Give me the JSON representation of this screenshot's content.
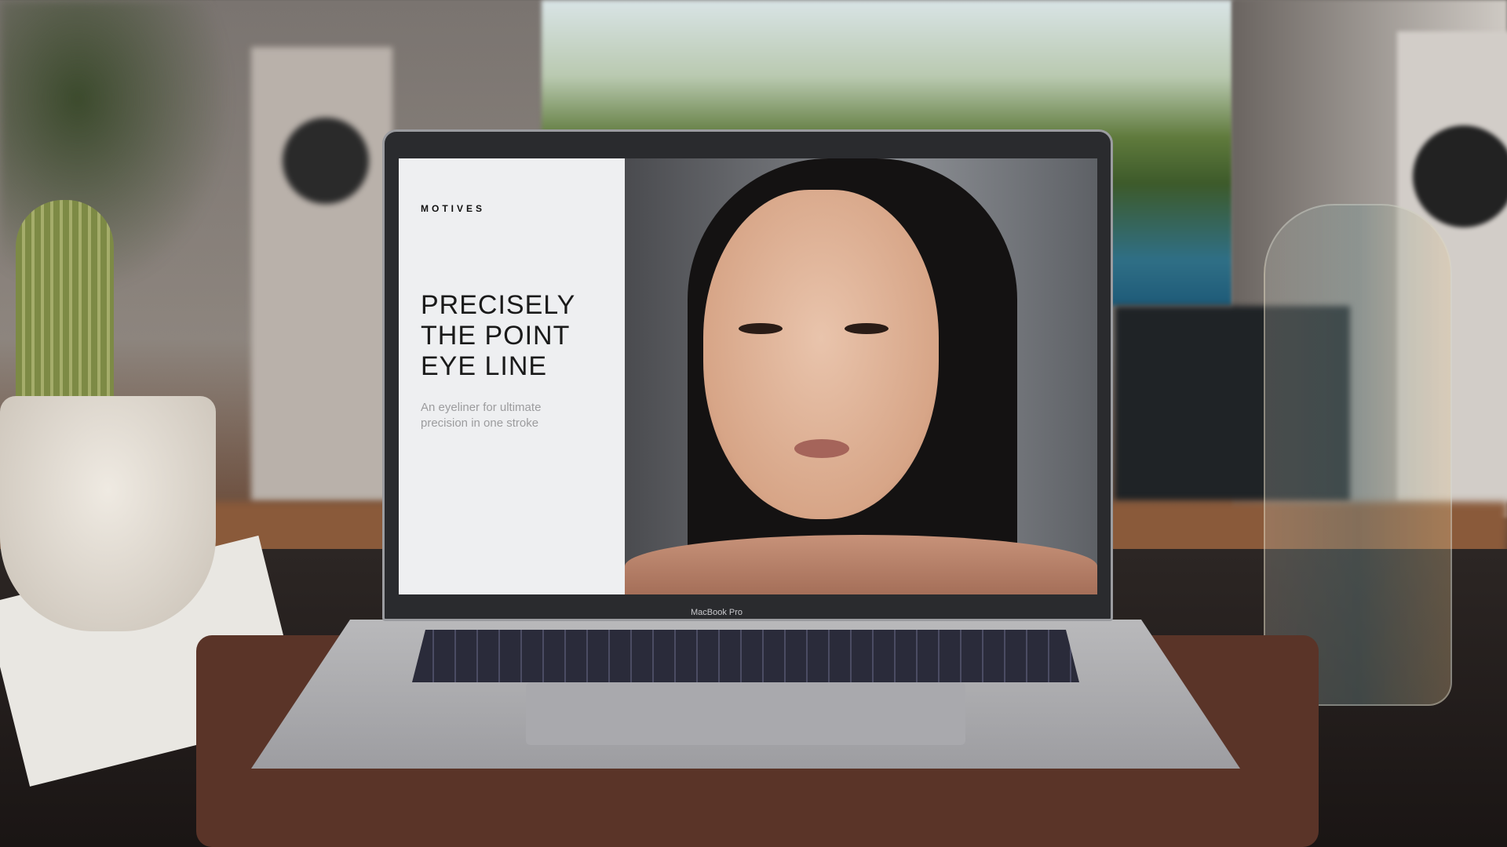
{
  "website": {
    "brand": "MOTIVES",
    "headline": [
      "PRECISELY",
      "THE POINT",
      "EYE LINE"
    ],
    "subtitle": "An eyeliner for ultimate precision in one stroke"
  },
  "laptop": {
    "model_label": "MacBook Pro"
  },
  "colors": {
    "panel_bg": "#eeeff1",
    "headline": "#1a1a1a",
    "subtitle": "#9c9c9e"
  }
}
